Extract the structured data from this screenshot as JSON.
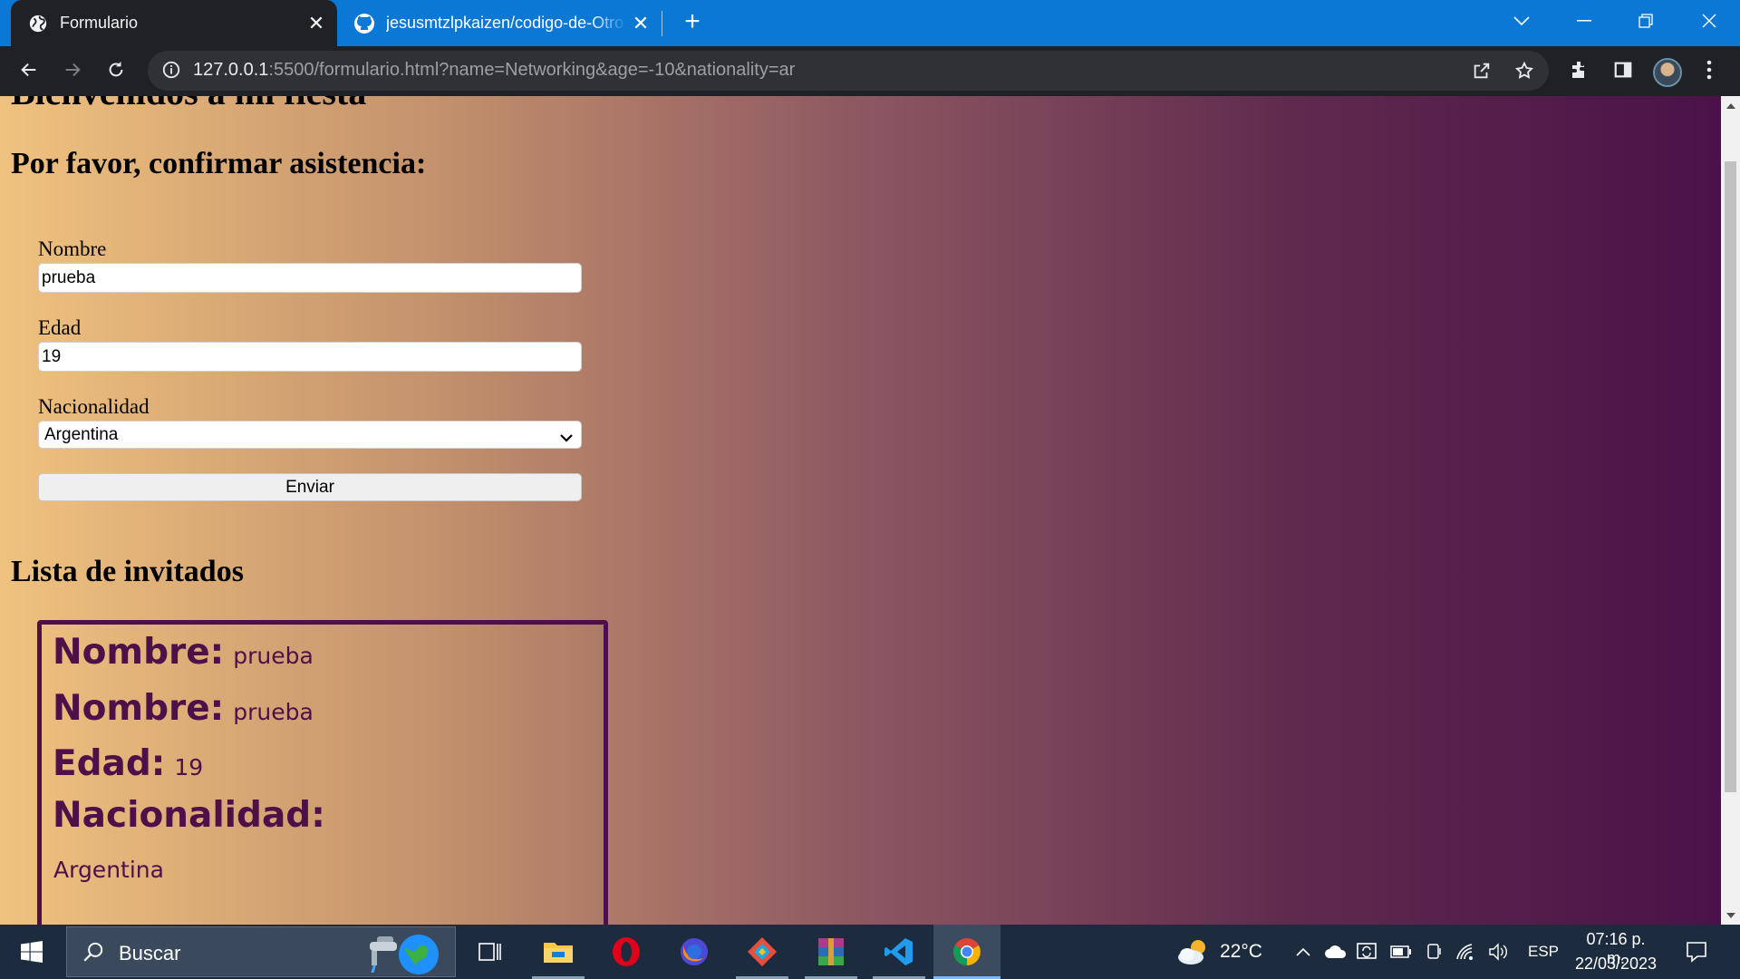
{
  "browser": {
    "tabs": [
      {
        "title": "Formulario",
        "favicon": "globe-icon",
        "active": true
      },
      {
        "title": "jesusmtzlpkaizen/codigo-de-Otro",
        "favicon": "github-icon",
        "active": false
      }
    ],
    "url_host": "127.0.0.1",
    "url_rest": ":5500/formulario.html?name=Networking&age=-10&nationality=ar"
  },
  "page": {
    "heading": "Bienvenidos a mi fiesta",
    "confirm_heading": "Por favor, confirmar asistencia:",
    "form": {
      "name_label": "Nombre",
      "name_value": "prueba",
      "age_label": "Edad",
      "age_value": "19",
      "nationality_label": "Nacionalidad",
      "nationality_value": "Argentina",
      "submit_label": "Enviar"
    },
    "guests_heading": "Lista de invitados",
    "guest_card": {
      "name_key": "Nombre:",
      "name_val": "prueba",
      "name_key_2": "Nombre:",
      "name_val_2": "prueba",
      "age_key": "Edad:",
      "age_val": "19",
      "nationality_key": "Nacionalidad:",
      "nationality_val": "Argentina"
    },
    "colors": {
      "gradient_start": "#f0c27f",
      "gradient_end": "#4a1248",
      "card_accent": "#4e1049"
    }
  },
  "taskbar": {
    "search_placeholder": "Buscar",
    "weather_temp": "22°C",
    "language": "ESP",
    "time": "07:16 p. m.",
    "date": "22/03/2023",
    "apps": [
      "task-view-icon",
      "file-explorer-icon",
      "opera-icon",
      "firefox-icon",
      "git-kraken-icon",
      "winrar-icon",
      "vscode-icon",
      "chrome-icon"
    ]
  }
}
